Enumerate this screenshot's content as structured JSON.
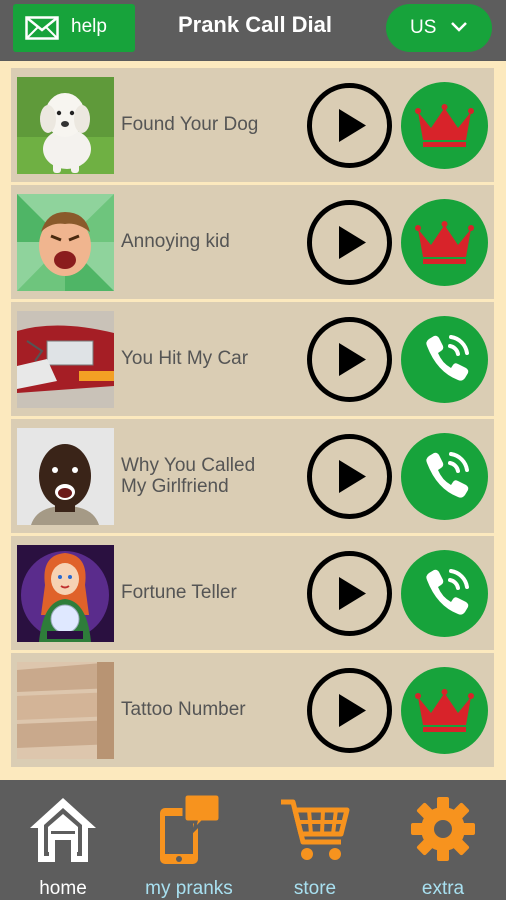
{
  "header": {
    "help_label": "help",
    "title": "Prank Call Dial",
    "country_label": "US"
  },
  "colors": {
    "brand_green": "#17a33b",
    "crown_red": "#d8232a",
    "orange": "#f7931e",
    "row_bg": "#dacdb4",
    "panel_bg": "#fce9be",
    "nav_bg": "#5d5d5d",
    "nav_active_text": "#ffffff",
    "nav_light_blue_text": "#a8e0f0"
  },
  "pranks": [
    {
      "label": "Found Your Dog",
      "thumb": "dog",
      "action": "premium",
      "action_icon": "crown-icon"
    },
    {
      "label": "Annoying kid",
      "thumb": "kid",
      "action": "premium",
      "action_icon": "crown-icon"
    },
    {
      "label": "You Hit My Car",
      "thumb": "car",
      "action": "call",
      "action_icon": "phone-call-icon"
    },
    {
      "label": "Why You Called My Girlfriend",
      "label_line1": "Why You Called",
      "label_line2": "My Girlfriend",
      "thumb": "man",
      "action": "call",
      "action_icon": "phone-call-icon"
    },
    {
      "label": "Fortune Teller",
      "thumb": "fortune",
      "action": "call",
      "action_icon": "phone-call-icon"
    },
    {
      "label": "Tattoo Number",
      "thumb": "tattoo",
      "action": "premium",
      "action_icon": "crown-icon"
    }
  ],
  "nav": {
    "home": "home",
    "my_pranks": "my pranks",
    "store": "store",
    "extra": "extra"
  }
}
